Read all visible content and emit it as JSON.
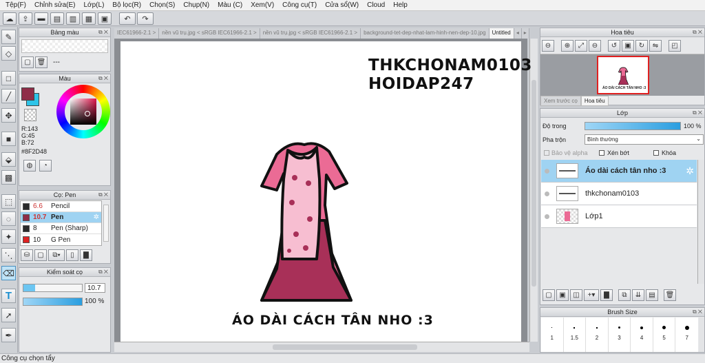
{
  "menu": [
    "Tệp(F)",
    "Chỉnh sửa(E)",
    "Lớp(L)",
    "Bộ lọc(R)",
    "Chọn(S)",
    "Chụp(N)",
    "Màu (C)",
    "Xem(V)",
    "Công cụ(T)",
    "Cửa sổ(W)",
    "Cloud",
    "Help"
  ],
  "tabs": [
    "IEC61966-2.1 >",
    "nền vũ trụ.jpg < sRGB IEC61966-2.1 >",
    "nền vũ trụ.jpg < sRGB IEC61966-2.1 >",
    "background-tet-dep-nhat-lam-hinh-nen-dep-10.jpg",
    "Untitled"
  ],
  "panels": {
    "palette": "Bảng màu",
    "palette_label": "---",
    "color": "Màu",
    "color_values": {
      "r": "R:143",
      "g": "G:45",
      "b": "B:72",
      "hex": "#8F2D48"
    },
    "brush": "Cọ: Pen",
    "brush_control": "Kiểm soát cọ",
    "size_value": "10.7",
    "opacity_value": "100 %",
    "navigator": "Hoa tiêu",
    "preview_tab": "Xem trước cọ",
    "navigator_tab": "Hoa tiêu",
    "layers": "Lớp",
    "brush_size": "Brush Size"
  },
  "brushes": [
    {
      "size": "6.6",
      "name": "Pencil",
      "color": "#2a2a2a"
    },
    {
      "size": "10.7",
      "name": "Pen",
      "color": "#8F2D48"
    },
    {
      "size": "8",
      "name": "Pen (Sharp)",
      "color": "#2a2a2a"
    },
    {
      "size": "10",
      "name": "G Pen",
      "color": "#d22"
    }
  ],
  "layer_props": {
    "opacity_label": "Độ trong",
    "opacity_value": "100 %",
    "blend_label": "Pha trộn",
    "blend_value": "Bình thường",
    "protect_alpha": "Bảo vệ alpha",
    "clipping": "Xén bớt",
    "lock": "Khóa"
  },
  "layers": [
    "Áo dài cách tân nho :3",
    "thkchonam0103",
    "Lớp1"
  ],
  "brush_sizes": [
    "1",
    "1.5",
    "2",
    "3",
    "4",
    "5",
    "7"
  ],
  "canvas_text": {
    "line1": "THKCHONAM0103",
    "line2": "HOIDAP247",
    "caption": "ÁO DÀI CÁCH TÂN NHO :3",
    "nav_caption": "ÁO DÀI CÁCH TÂN NHO :3"
  },
  "status": "Công cụ chọn tẩy",
  "colors": {
    "main": "#8F2D48",
    "sub": "#2EC4E8",
    "accent": "#9fd3f2"
  }
}
